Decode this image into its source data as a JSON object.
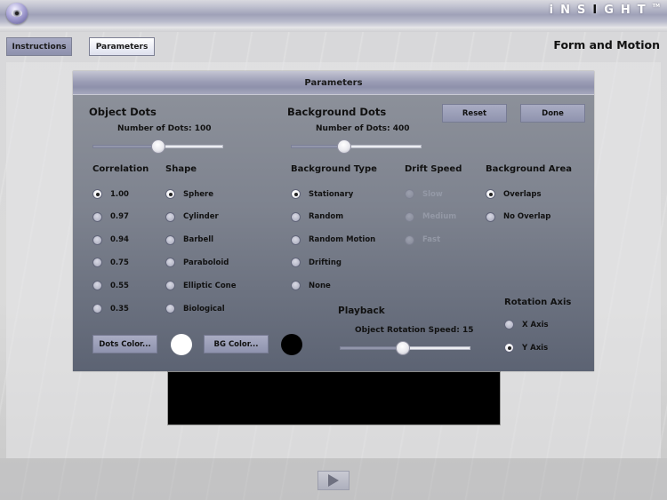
{
  "app": {
    "brand": {
      "pre": "iNS",
      "mid": "I",
      "post": "GHT",
      "tm": "TM"
    },
    "page_title": "Form and Motion"
  },
  "nav": {
    "instructions_label": "Instructions",
    "parameters_label": "Parameters",
    "active": "Parameters"
  },
  "panel": {
    "title": "Parameters",
    "reset_label": "Reset",
    "done_label": "Done",
    "object_dots": {
      "title": "Object Dots",
      "count_label": "Number of Dots: 100",
      "count": 100,
      "slider_fraction": 0.5
    },
    "background_dots": {
      "title": "Background Dots",
      "count_label": "Number of Dots: 400",
      "count": 400,
      "slider_fraction": 0.4
    },
    "correlation": {
      "title": "Correlation",
      "options": [
        "1.00",
        "0.97",
        "0.94",
        "0.75",
        "0.55",
        "0.35"
      ],
      "selected": "1.00"
    },
    "shape": {
      "title": "Shape",
      "options": [
        "Sphere",
        "Cylinder",
        "Barbell",
        "Paraboloid",
        "Elliptic Cone",
        "Biological"
      ],
      "selected": "Sphere"
    },
    "background_type": {
      "title": "Background Type",
      "options": [
        "Stationary",
        "Random",
        "Random Motion",
        "Drifting",
        "None"
      ],
      "selected": "Stationary"
    },
    "drift_speed": {
      "title": "Drift Speed",
      "options": [
        "Slow",
        "Medium",
        "Fast"
      ],
      "selected": null,
      "disabled": true
    },
    "background_area": {
      "title": "Background Area",
      "options": [
        "Overlaps",
        "No Overlap"
      ],
      "selected": "Overlaps"
    },
    "dots_color_label": "Dots Color...",
    "dots_color": "#ffffff",
    "bg_color_label": "BG Color...",
    "bg_color": "#000000",
    "playback": {
      "title": "Playback",
      "speed_label": "Object Rotation Speed: 15",
      "speed": 15,
      "slider_fraction": 0.48
    },
    "rotation_axis": {
      "title": "Rotation Axis",
      "options": [
        "X Axis",
        "Y Axis"
      ],
      "selected": "Y Axis"
    }
  },
  "player": {
    "play_icon": "play-icon"
  }
}
